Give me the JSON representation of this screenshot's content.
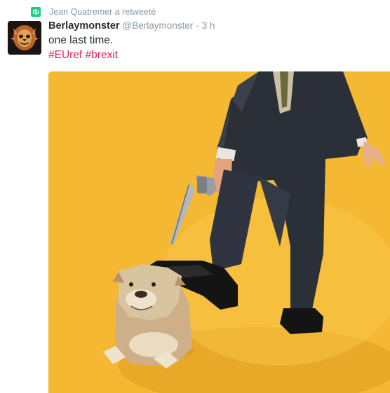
{
  "retweet": {
    "icon": "retweet-icon",
    "text": "Jean Quatremer a retweeté",
    "icon_color": "#19cf86"
  },
  "tweet": {
    "avatar_icon": "monster-avatar",
    "display_name": "Berlaymonster",
    "handle": "@Berlaymonster",
    "separator": "·",
    "time": "3 h",
    "text": "one last time.",
    "hashtags": [
      "#EUref",
      "#brexit"
    ]
  },
  "media": {
    "subject": "man-pointing-revolver-at-bulldog",
    "background_color": "#f4b832"
  },
  "colors": {
    "name": "#292f33",
    "secondary": "#8899a6",
    "hashtag": "#e0245e"
  }
}
